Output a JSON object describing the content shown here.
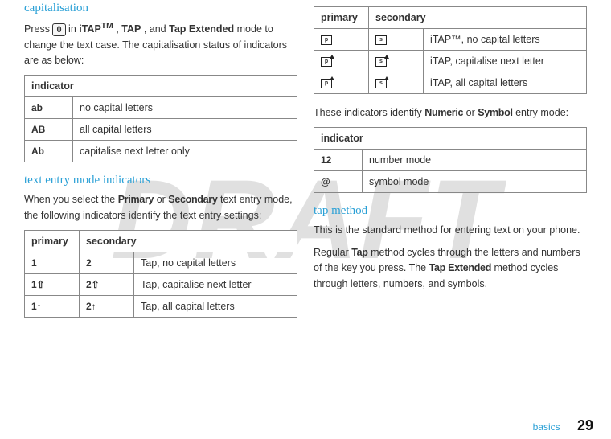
{
  "watermark": "DRAFT",
  "left": {
    "heading_cap": "capitalisation",
    "cap_para_pre": "Press ",
    "cap_key": "0",
    "cap_para_mid": " in ",
    "cap_mode1": "iTAP",
    "cap_mode1_tm": "TM",
    "cap_sep1": ", ",
    "cap_mode2": "TAP",
    "cap_sep2": ", and ",
    "cap_mode3": "Tap Extended",
    "cap_para_post": " mode to change the text case. The capitalisation status of indicators are as below:",
    "cap_table": {
      "header": "indicator",
      "rows": [
        {
          "sym": "ab",
          "desc": "no capital letters"
        },
        {
          "sym": "AB",
          "desc": "all capital letters"
        },
        {
          "sym": "Ab",
          "desc": "capitalise next letter only"
        }
      ]
    },
    "heading_modes": "text entry mode indicators",
    "modes_para_pre": "When you select the ",
    "modes_w1": "Primary",
    "modes_mid": " or ",
    "modes_w2": "Secondary",
    "modes_para_post": " text entry mode, the following indicators identify the text entry settings:",
    "tap_table": {
      "header_p": "primary",
      "header_s": "secondary",
      "rows": [
        {
          "p": "1",
          "s": "2",
          "desc": "Tap, no capital letters"
        },
        {
          "p": "1⇧",
          "s": "2⇧",
          "desc": "Tap, capitalise next letter"
        },
        {
          "p": "1↑",
          "s": "2↑",
          "desc": "Tap, all capital letters"
        }
      ]
    }
  },
  "right": {
    "itap_table": {
      "header_p": "primary",
      "header_s": "secondary",
      "rows": [
        {
          "p": "p",
          "s": "s",
          "up": false,
          "desc": "iTAP™, no capital letters"
        },
        {
          "p": "p",
          "s": "s",
          "up": true,
          "desc": "iTAP, capitalise next letter"
        },
        {
          "p": "p",
          "s": "s",
          "up": true,
          "desc": "iTAP, all capital letters"
        }
      ]
    },
    "between_para_pre": "These indicators identify ",
    "between_w1": "Numeric",
    "between_mid": " or ",
    "between_w2": "Symbol",
    "between_para_post": " entry mode:",
    "numsym_table": {
      "header": "indicator",
      "rows": [
        {
          "sym": "12",
          "desc": "number mode"
        },
        {
          "sym": "@",
          "desc": "symbol mode"
        }
      ]
    },
    "heading_tap": "tap method",
    "tap_p1": "This is the standard method for entering text on your phone.",
    "tap_p2_pre": "Regular ",
    "tap_p2_w1": "Tap",
    "tap_p2_mid": " method cycles through the letters and numbers of the key you press. The ",
    "tap_p2_w2": "Tap Extended",
    "tap_p2_post": " method cycles through letters, numbers, and symbols."
  },
  "footer": {
    "section": "basics",
    "page": "29"
  }
}
